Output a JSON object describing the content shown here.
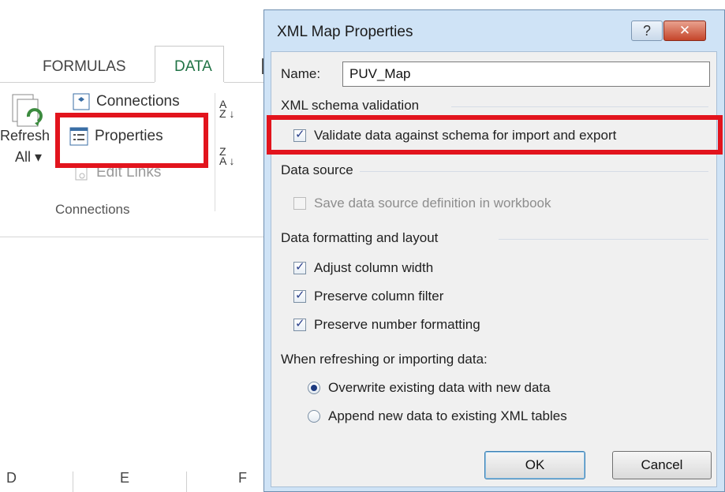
{
  "excel": {
    "tabs": {
      "formulas": "FORMULAS",
      "data": "DATA"
    },
    "ribbon": {
      "refresh_label": "Refresh",
      "refresh_all": "All",
      "connections": "Connections",
      "properties": "Properties",
      "edit_links": "Edit Links",
      "group_label": "Connections",
      "sort_az": "A\nZ",
      "sort_za": "Z\nA"
    },
    "columns": [
      "D",
      "E",
      "F"
    ]
  },
  "dialog": {
    "title": "XML Map Properties",
    "help_glyph": "?",
    "close_glyph": "✕",
    "name_label": "Name:",
    "name_value": "PUV_Map",
    "schema_section": "XML schema validation",
    "validate_label": "Validate data against schema for import and export",
    "validate_checked": true,
    "source_section": "Data source",
    "save_source_label": "Save data source definition in workbook",
    "save_source_checked": false,
    "format_section": "Data formatting and layout",
    "adjust_width_label": "Adjust column width",
    "preserve_filter_label": "Preserve column filter",
    "preserve_number_label": "Preserve number formatting",
    "refresh_prompt": "When refreshing or importing data:",
    "overwrite_label": "Overwrite existing data with new data",
    "append_label": "Append new data to existing XML tables",
    "ok_label": "OK",
    "cancel_label": "Cancel"
  },
  "colors": {
    "highlight": "#e2141d",
    "data_tab": "#217346"
  }
}
